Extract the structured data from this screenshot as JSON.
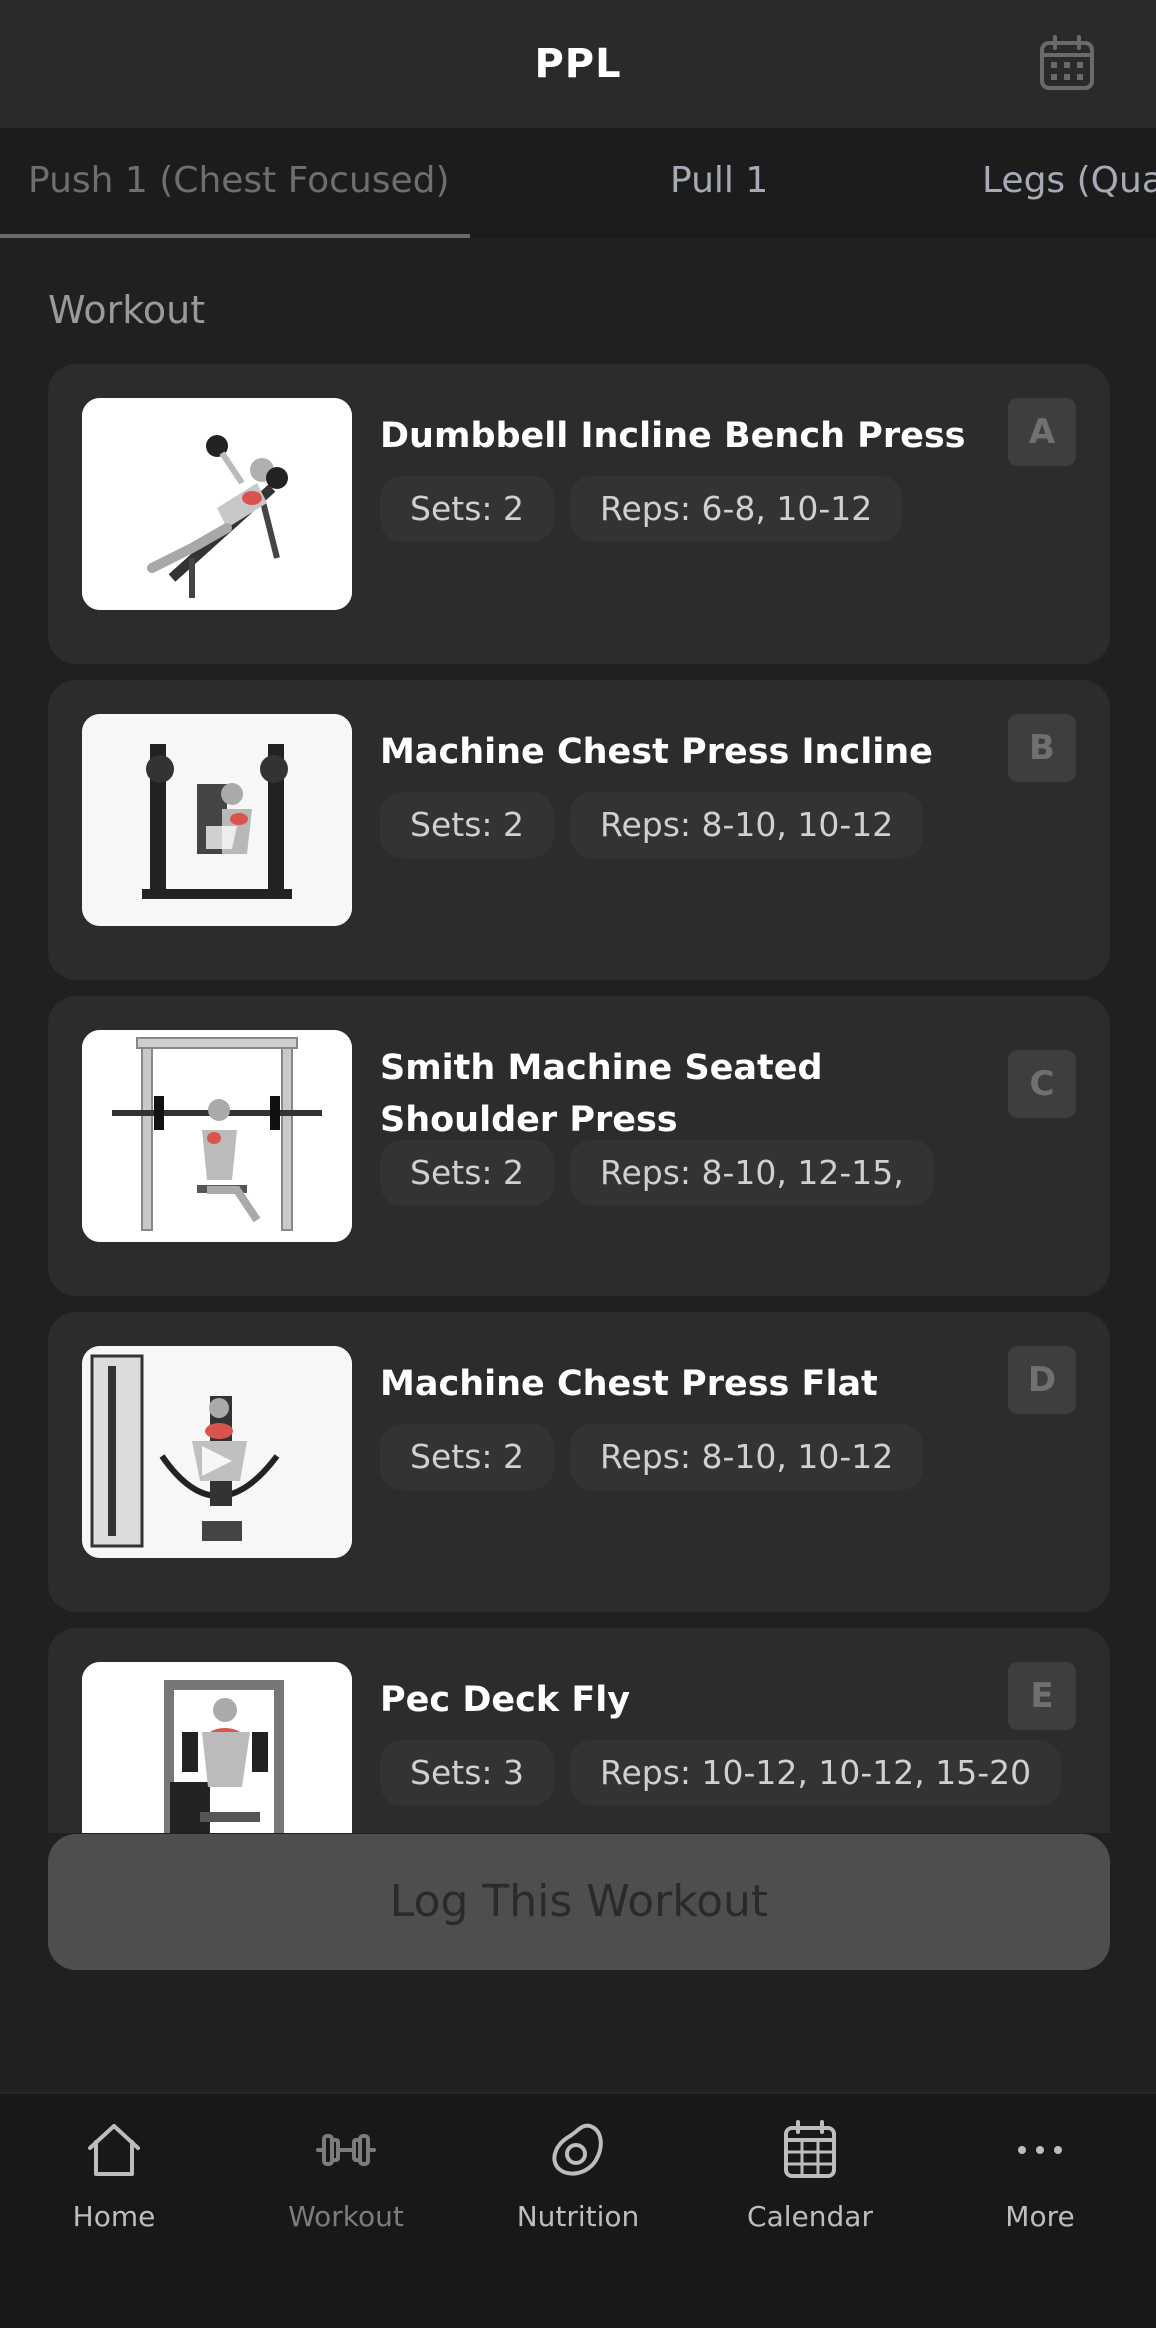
{
  "header": {
    "title": "PPL",
    "calendar_icon": "calendar-icon"
  },
  "tabs": [
    {
      "label": "Push 1 (Chest Focused)",
      "active": true
    },
    {
      "label": "Pull 1",
      "active": false
    },
    {
      "label": "Legs (Quad",
      "active": false
    }
  ],
  "section_label": "Workout",
  "exercises": [
    {
      "name": "Dumbbell Incline Bench Press",
      "sets": "Sets: 2",
      "reps": "Reps: 6-8, 10-12",
      "badge": "A"
    },
    {
      "name": "Machine Chest Press Incline",
      "sets": "Sets: 2",
      "reps": "Reps: 8-10, 10-12",
      "badge": "B"
    },
    {
      "name": "Smith Machine Seated Shoulder Press",
      "sets": "Sets: 2",
      "reps": "Reps: 8-10, 12-15,",
      "badge": "C"
    },
    {
      "name": "Machine Chest Press Flat",
      "sets": "Sets: 2",
      "reps": "Reps: 8-10, 10-12",
      "badge": "D"
    },
    {
      "name": "Pec Deck Fly",
      "sets": "Sets: 3",
      "reps": "Reps: 10-12, 10-12, 15-20",
      "badge": "E"
    }
  ],
  "log_button": "Log This Workout",
  "nav": [
    {
      "label": "Home",
      "icon": "home-icon"
    },
    {
      "label": "Workout",
      "icon": "dumbbell-icon",
      "active": true
    },
    {
      "label": "Nutrition",
      "icon": "avocado-icon"
    },
    {
      "label": "Calendar",
      "icon": "calendar-icon"
    },
    {
      "label": "More",
      "icon": "more-icon"
    }
  ],
  "colors": {
    "background": "#202020",
    "card": "#2c2c2c",
    "pill": "#333333",
    "header": "#2a2a2a"
  }
}
